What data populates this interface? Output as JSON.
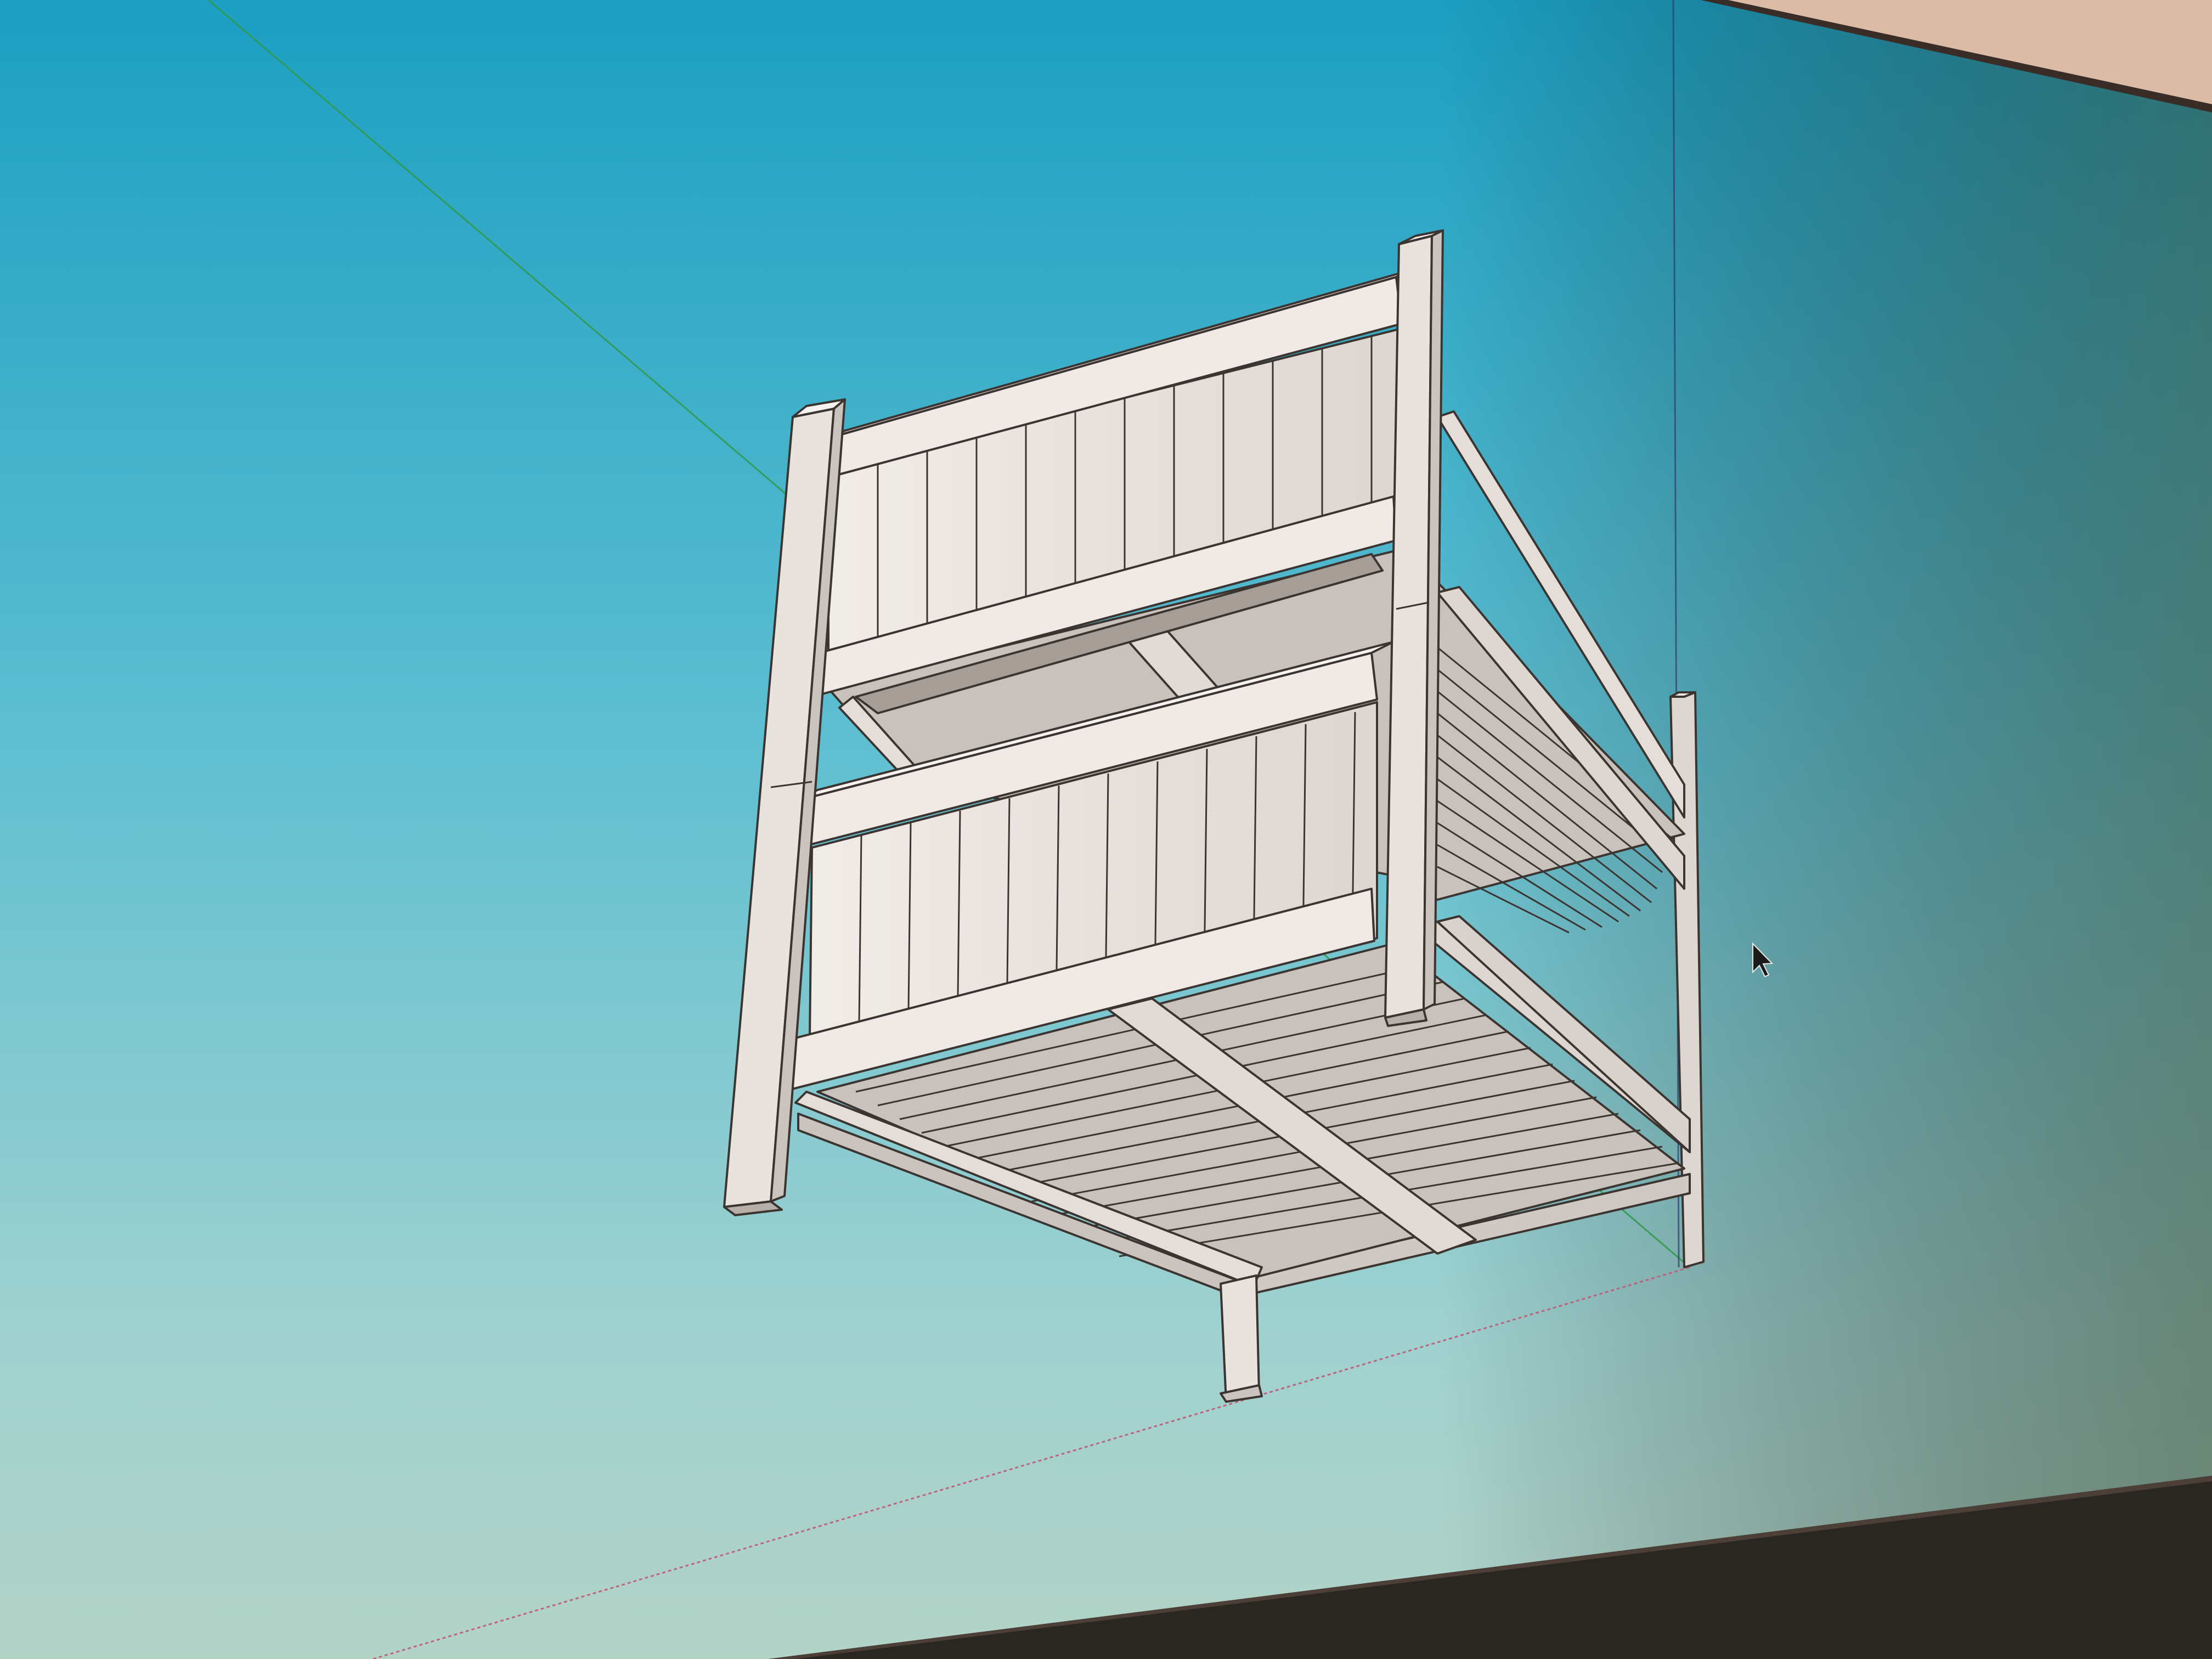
{
  "viewport": {
    "background_top": "#1fa3c4",
    "background_mid": "#7ccad7",
    "background_bottom": "#a9cfc6",
    "background_right": "#6c8a78",
    "monitor_bezel": "#2a2622",
    "room_wall": "#d9b9a4"
  },
  "axes": {
    "green_axis_color": "#2f9a48",
    "red_axis_color": "#c05a78",
    "blue_axis_color": "#2b3f6e"
  },
  "model": {
    "name": "bunk-bed",
    "fill_light": "#ece6e1",
    "fill_mid": "#d6cfca",
    "fill_dark": "#b7aea8",
    "edge_color": "#3b3431"
  },
  "cursor": {
    "icon": "arrow-cursor-icon",
    "color": "#1b1b1b"
  }
}
